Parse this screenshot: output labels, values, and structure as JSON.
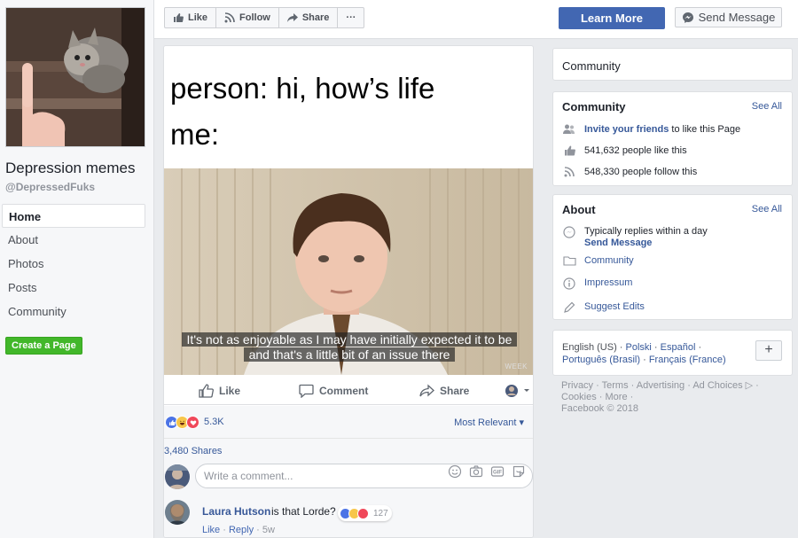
{
  "page": {
    "name": "Depression memes",
    "handle": "@DepressedFuks"
  },
  "nav": {
    "items": [
      {
        "label": "Home",
        "active": true
      },
      {
        "label": "About"
      },
      {
        "label": "Photos"
      },
      {
        "label": "Posts"
      },
      {
        "label": "Community"
      }
    ],
    "create_page": "Create a Page"
  },
  "topbar": {
    "like": "Like",
    "follow": "Follow",
    "share": "Share",
    "more": "···",
    "learn_more": "Learn More",
    "send_message": "Send Message"
  },
  "post": {
    "meme_line1": "person: hi, how’s life",
    "meme_line2": "me:",
    "subtitle": "It's not as enjoyable as I may have initially expected it to be and that's a little bit of an issue there",
    "watermark": "WEEK",
    "actions": {
      "like": "Like",
      "comment": "Comment",
      "share": "Share"
    },
    "reaction_count": "5.3K",
    "sort": "Most Relevant ▾",
    "shares": "3,480 Shares",
    "comment_placeholder": "Write a comment...",
    "comment": {
      "author": "Laura Hutson",
      "text": "is that Lorde?",
      "reactions": "127",
      "like": "Like",
      "reply": "Reply",
      "time": "5w"
    }
  },
  "right": {
    "community_header": "Community",
    "community_card": {
      "title": "Community",
      "see_all": "See All",
      "invite_link": "Invite your friends",
      "invite_rest": "to like this Page",
      "likes": "541,632 people like this",
      "follows": "548,330 people follow this"
    },
    "about_card": {
      "title": "About",
      "see_all": "See All",
      "replies": "Typically replies within a day",
      "send_message": "Send Message",
      "category": "Community",
      "impressum": "Impressum",
      "suggest_edits": "Suggest Edits"
    },
    "languages": {
      "current": "English (US)",
      "l1": "Polski",
      "l2": "Español",
      "l3": "Português (Brasil)",
      "l4": "Français (France)",
      "plus": "+"
    },
    "footer": {
      "line1": "Privacy · Terms · Advertising · Ad Choices ▷ ·",
      "line2": "Cookies · More ·",
      "line3": "Facebook © 2018"
    }
  },
  "colors": {
    "brand_blue": "#4267b2",
    "green": "#42b72a",
    "link": "#365899"
  }
}
